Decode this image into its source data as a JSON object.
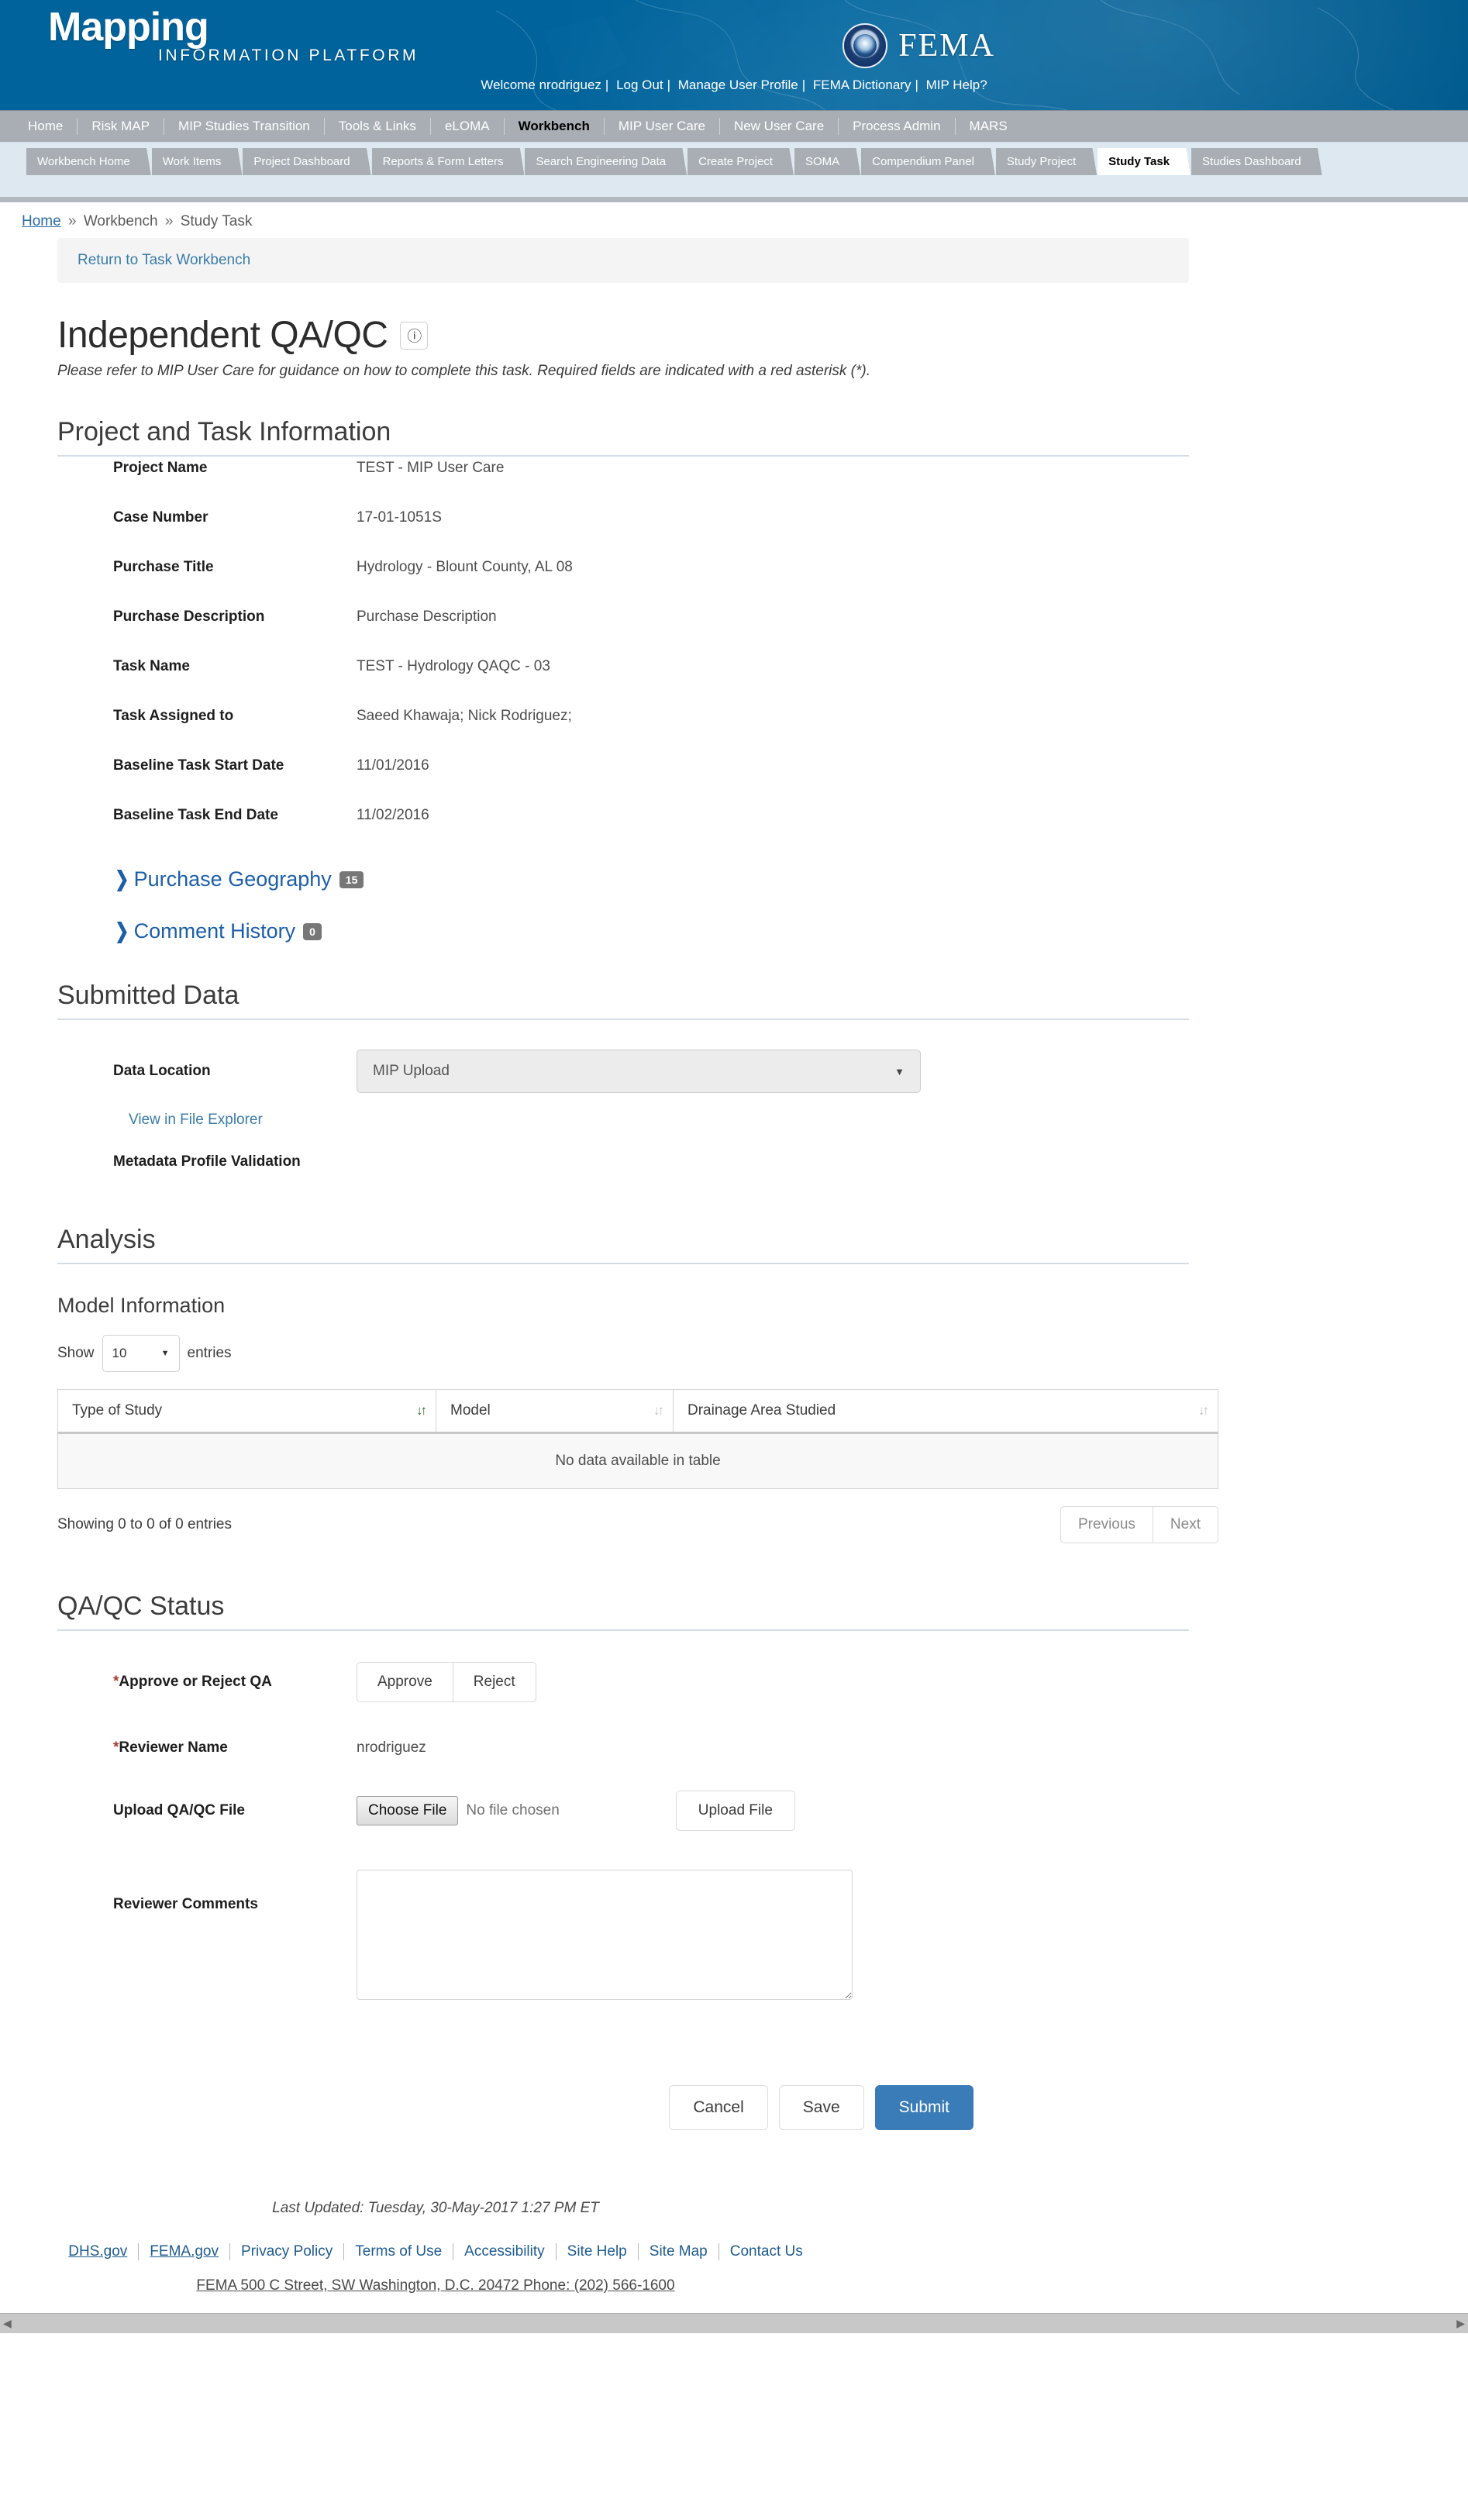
{
  "masthead": {
    "brand_line1": "Mapping",
    "brand_line2": "INFORMATION PLATFORM",
    "agency": "FEMA",
    "util_links": [
      "Welcome nrodriguez",
      "Log Out",
      "Manage User Profile",
      "FEMA Dictionary",
      "MIP Help?"
    ]
  },
  "primary_nav": {
    "items": [
      {
        "label": "Home",
        "active": false
      },
      {
        "label": "Risk MAP",
        "active": false
      },
      {
        "label": "MIP Studies Transition",
        "active": false
      },
      {
        "label": "Tools & Links",
        "active": false
      },
      {
        "label": "eLOMA",
        "active": false
      },
      {
        "label": "Workbench",
        "active": true
      },
      {
        "label": "MIP User Care",
        "active": false
      },
      {
        "label": "New User Care",
        "active": false
      },
      {
        "label": "Process Admin",
        "active": false
      },
      {
        "label": "MARS",
        "active": false
      }
    ]
  },
  "tab_nav": {
    "tabs": [
      {
        "label": "Workbench Home",
        "active": false
      },
      {
        "label": "Work Items",
        "active": false
      },
      {
        "label": "Project Dashboard",
        "active": false
      },
      {
        "label": "Reports & Form Letters",
        "active": false
      },
      {
        "label": "Search Engineering Data",
        "active": false
      },
      {
        "label": "Create Project",
        "active": false
      },
      {
        "label": "SOMA",
        "active": false
      },
      {
        "label": "Compendium Panel",
        "active": false
      },
      {
        "label": "Study Project",
        "active": false
      },
      {
        "label": "Study Task",
        "active": true
      },
      {
        "label": "Studies Dashboard",
        "active": false
      }
    ]
  },
  "breadcrumb": {
    "home": "Home",
    "sep1": "»",
    "level2": "Workbench",
    "sep2": "»",
    "level3": "Study Task"
  },
  "return_bar": {
    "label": "Return to Task Workbench"
  },
  "header": {
    "title": "Independent QA/QC",
    "help_icon": "question-mark-circle-icon",
    "subtitle": "Please refer to MIP User Care for guidance on how to complete this task. Required fields are indicated with a red asterisk (*)."
  },
  "project_info": {
    "heading": "Project and Task Information",
    "fields": [
      {
        "label": "Project Name",
        "value": "TEST - MIP User Care"
      },
      {
        "label": "Case Number",
        "value": "17-01-1051S"
      },
      {
        "label": "Purchase Title",
        "value": "Hydrology - Blount County, AL 08"
      },
      {
        "label": "Purchase Description",
        "value": "Purchase Description"
      },
      {
        "label": "Task Name",
        "value": "TEST - Hydrology QAQC - 03"
      },
      {
        "label": "Task Assigned to",
        "value": "Saeed Khawaja; Nick Rodriguez;"
      },
      {
        "label": "Baseline Task Start Date",
        "value": "11/01/2016"
      },
      {
        "label": "Baseline Task End Date",
        "value": "11/02/2016"
      }
    ]
  },
  "accordions": [
    {
      "label": "Purchase Geography",
      "count": "15",
      "icon": "chevron-right-icon"
    },
    {
      "label": "Comment History",
      "count": "0",
      "icon": "chevron-right-icon"
    }
  ],
  "submitted_data": {
    "heading": "Submitted Data",
    "data_location_label": "Data Location",
    "data_location_value": "MIP Upload",
    "view_file_explorer": "View in File Explorer",
    "metadata_profile_validation": "Metadata Profile Validation"
  },
  "analysis": {
    "heading": "Analysis",
    "model_info_heading": "Model Information",
    "show_label": "Show",
    "entries_label": "entries",
    "page_length": "10",
    "columns": [
      "Type of Study",
      "Model",
      "Drainage Area Studied"
    ],
    "empty_message": "No data available in table",
    "info": "Showing 0 to 0 of 0 entries",
    "previous_label": "Previous",
    "next_label": "Next"
  },
  "qaqc_status": {
    "heading": "QA/QC Status",
    "approve_reject_label": "Approve or Reject QA",
    "approve_label": "Approve",
    "reject_label": "Reject",
    "reviewer_name_label": "Reviewer Name",
    "reviewer_name_value": "nrodriguez",
    "upload_label": "Upload QA/QC File",
    "choose_file_label": "Choose File",
    "no_file_chosen": "No file chosen",
    "upload_file_label": "Upload File",
    "comments_label": "Reviewer Comments",
    "comments_value": ""
  },
  "actions": {
    "cancel": "Cancel",
    "save": "Save",
    "submit": "Submit"
  },
  "footer": {
    "last_updated": "Last Updated: Tuesday, 30-May-2017 1:27 PM ET",
    "links": [
      "DHS.gov",
      "FEMA.gov",
      "Privacy Policy",
      "Terms of Use",
      "Accessibility",
      "Site Help",
      "Site Map",
      "Contact Us"
    ],
    "address": "FEMA 500 C Street, SW Washington, D.C. 20472 Phone: (202) 566-1600"
  },
  "colors": {
    "masthead_blue": "#00639b",
    "nav_gray": "#a9aeb5",
    "tab_strip_blue": "#dde8f1",
    "link_blue": "#1c5fa8",
    "primary_button": "#3a7cb8",
    "required_red": "#a23b32",
    "badge_gray": "#777777",
    "sort_active_green": "#2e6b2e"
  }
}
